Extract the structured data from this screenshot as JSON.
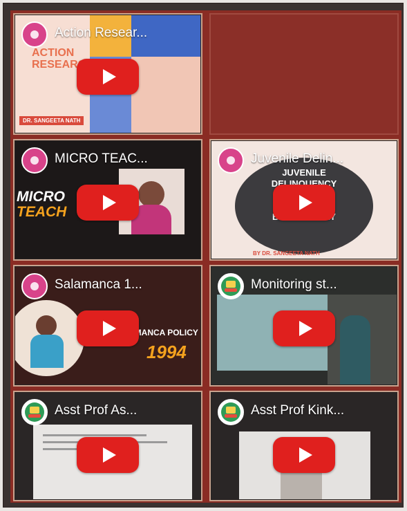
{
  "videos": [
    {
      "title": "Action Resear...",
      "overlay": [
        "ACTION",
        "RESEARCH"
      ],
      "caption": "DR. SANGEETA NATH"
    },
    {
      "title": "MICRO TEAC...",
      "overlay": [
        "MICRO",
        "TEACH"
      ]
    },
    {
      "title": "Juvenile Delin...",
      "overlay": [
        "JUVENILE",
        "DELINQUENCY",
        "&",
        "TRAUMATIC",
        "BRAIN INJURY"
      ],
      "caption": "BY DR. SANGEETA NATH"
    },
    {
      "title": "Salamanca 1...",
      "overlay": [
        "SALAMANCA POLICY",
        "1994"
      ]
    },
    {
      "title": "Monitoring st..."
    },
    {
      "title": "Asst Prof As..."
    },
    {
      "title": "Asst Prof Kink..."
    }
  ],
  "colors": {
    "youtube_red": "#e0201e",
    "channel_pink": "#d8438a",
    "school_green": "#2f9b57",
    "grid_bg": "#8a2c24"
  },
  "icons": {
    "play": "youtube-play-icon",
    "channel": "channel-avatar-icon",
    "school": "school-logo-icon"
  }
}
